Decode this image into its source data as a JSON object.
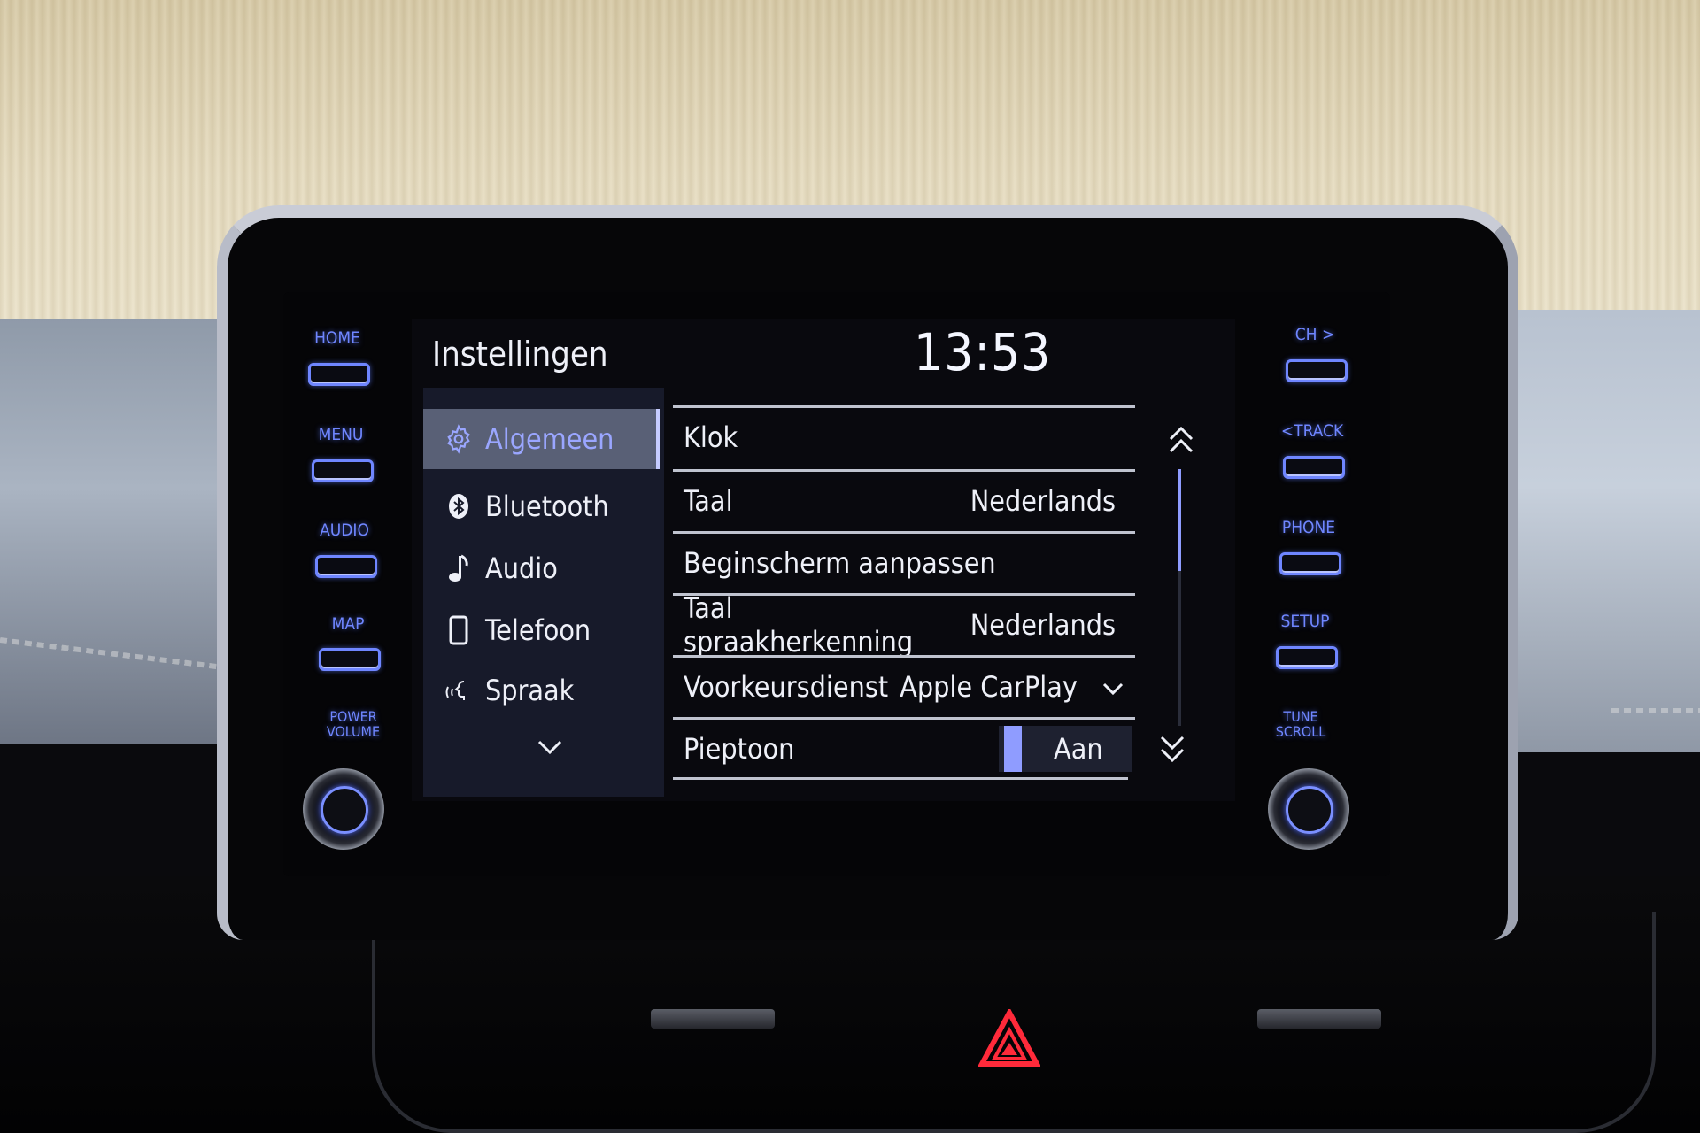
{
  "screen": {
    "title": "Instellingen",
    "clock": "13:53",
    "sidebar": {
      "items": [
        {
          "label": "Algemeen",
          "icon": "gear-icon",
          "selected": true
        },
        {
          "label": "Bluetooth",
          "icon": "bluetooth-icon",
          "selected": false
        },
        {
          "label": "Audio",
          "icon": "music-note-icon",
          "selected": false
        },
        {
          "label": "Telefoon",
          "icon": "phone-icon",
          "selected": false
        },
        {
          "label": "Spraak",
          "icon": "voice-icon",
          "selected": false
        }
      ],
      "more_icon": "chevron-down-icon"
    },
    "settings": [
      {
        "label": "Klok",
        "value": ""
      },
      {
        "label": "Taal",
        "value": "Nederlands"
      },
      {
        "label": "Beginscherm aanpassen",
        "value": ""
      },
      {
        "label": "Taal spraakherkenning",
        "value": "Nederlands"
      },
      {
        "label": "Voorkeursdienst",
        "value": "Apple CarPlay",
        "control": "dropdown"
      },
      {
        "label": "Pieptoon",
        "value": "Aan",
        "control": "toggle",
        "on": true
      }
    ],
    "scroll": {
      "up_icon": "double-chevron-up-icon",
      "down_icon": "double-chevron-down-icon"
    },
    "colors": {
      "accent": "#8f9cff",
      "selected_bg": "#596076",
      "selected_text": "#9aa6ff",
      "text": "#eef0f8"
    }
  },
  "hardware": {
    "left_buttons": [
      "HOME",
      "MENU",
      "AUDIO",
      "MAP"
    ],
    "left_knob_label": [
      "POWER",
      "VOLUME"
    ],
    "right_buttons": [
      "CH >",
      "<TRACK",
      "PHONE",
      "SETUP"
    ],
    "right_knob_label": [
      "TUNE",
      "SCROLL"
    ],
    "button_glow_color": "#6f86ff",
    "hazard_color": "#ff2a3a"
  }
}
